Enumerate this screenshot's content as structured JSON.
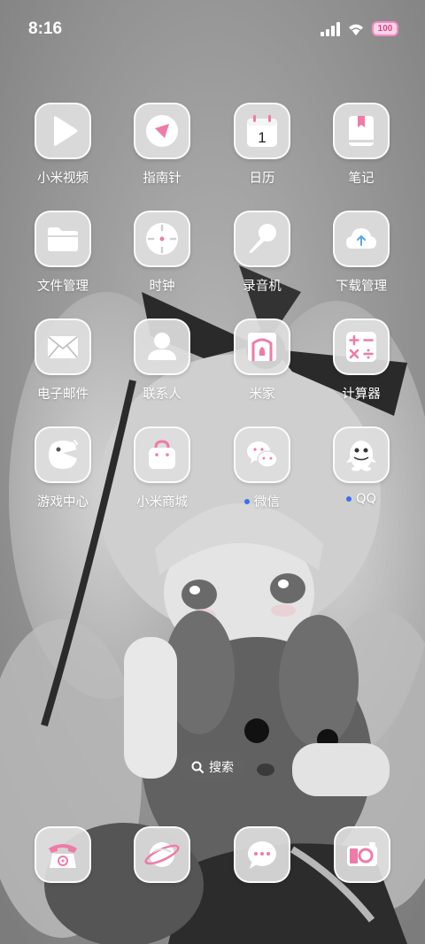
{
  "status_bar": {
    "time": "8:16",
    "battery_level": "100",
    "signal_icon": "signal-bars-icon",
    "wifi_icon": "wifi-icon"
  },
  "apps": [
    {
      "label": "小米视频",
      "icon": "play-icon"
    },
    {
      "label": "指南针",
      "icon": "compass-icon"
    },
    {
      "label": "日历",
      "icon": "calendar-icon",
      "badge_text": "1"
    },
    {
      "label": "笔记",
      "icon": "notebook-icon"
    },
    {
      "label": "文件管理",
      "icon": "folder-icon"
    },
    {
      "label": "时钟",
      "icon": "clock-icon"
    },
    {
      "label": "录音机",
      "icon": "microphone-icon"
    },
    {
      "label": "下载管理",
      "icon": "cloud-download-icon"
    },
    {
      "label": "电子邮件",
      "icon": "envelope-icon"
    },
    {
      "label": "联系人",
      "icon": "person-icon"
    },
    {
      "label": "米家",
      "icon": "home-icon"
    },
    {
      "label": "计算器",
      "icon": "calculator-icon"
    },
    {
      "label": "游戏中心",
      "icon": "game-bird-icon"
    },
    {
      "label": "小米商城",
      "icon": "shopping-bag-icon"
    },
    {
      "label": "微信",
      "icon": "wechat-icon",
      "new_install_dot": true
    },
    {
      "label": "QQ",
      "icon": "penguin-icon",
      "new_install_dot": true
    }
  ],
  "search": {
    "label": "搜索",
    "icon": "search-icon"
  },
  "dock": [
    {
      "icon": "telephone-icon"
    },
    {
      "icon": "browser-planet-icon"
    },
    {
      "icon": "message-bubble-icon"
    },
    {
      "icon": "camera-icon"
    }
  ],
  "colors": {
    "accent_pink": "#f07aa8",
    "icon_glyph_white": "#ffffff",
    "new_dot_blue": "#3b6ff0"
  }
}
